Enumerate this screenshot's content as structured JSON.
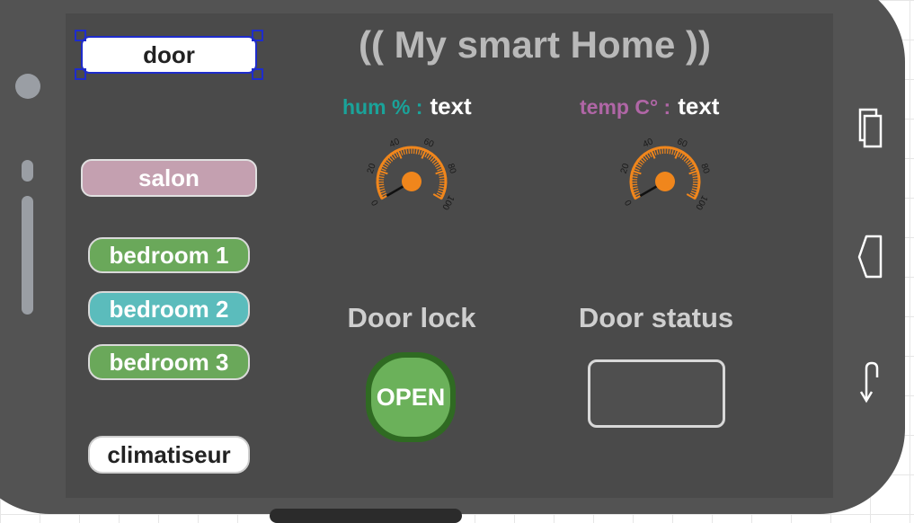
{
  "app": {
    "title": "(( My smart Home ))"
  },
  "sidebar": {
    "door_label": "door",
    "salon_label": "salon",
    "bedroom1_label": "bedroom 1",
    "bedroom2_label": "bedroom 2",
    "bedroom3_label": "bedroom 3",
    "clim_label": "climatiseur"
  },
  "sensors": {
    "humidity": {
      "label": "hum % :",
      "value": "text",
      "color": "#1aa39a"
    },
    "temperature": {
      "label": "temp C° :",
      "value": "text",
      "color": "#b066a6"
    },
    "gauge_ticks": [
      "0",
      "20",
      "40",
      "60",
      "80",
      "100"
    ]
  },
  "door_lock": {
    "heading": "Door lock",
    "button_label": "OPEN"
  },
  "door_status": {
    "heading": "Door status",
    "value": ""
  },
  "colors": {
    "bedroom1": "#6aa85a",
    "bedroom2": "#5bbcbc",
    "bedroom3": "#6aa85a",
    "gauge_accent": "#f0861c"
  },
  "nav_icons": [
    "recent-apps-icon",
    "home-icon",
    "back-icon"
  ]
}
